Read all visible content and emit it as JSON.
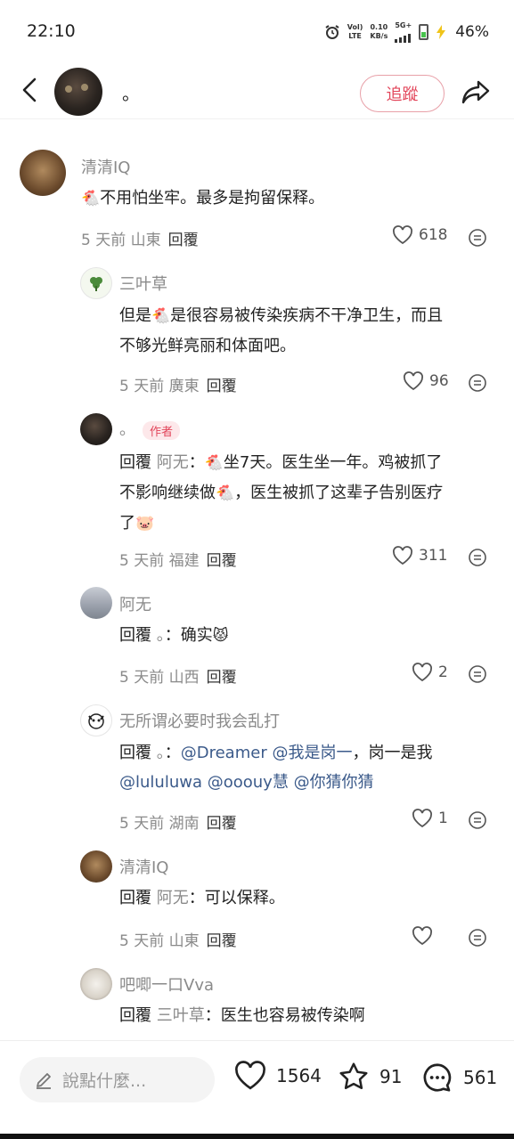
{
  "status_bar": {
    "time": "22:10",
    "volte": "Vol)",
    "lte": "LTE",
    "speed_value": "0.10",
    "speed_unit": "KB/s",
    "network": "5G+",
    "battery_pct": "46%"
  },
  "header": {
    "author_name": "。",
    "follow_label": "追蹤"
  },
  "comments": [
    {
      "name": "清清IQ",
      "text": "不用怕坐牢。最多是拘留保释。",
      "meta": "5 天前 山東",
      "reply_label": "回覆",
      "likes": "618"
    },
    {
      "name": "三叶草",
      "line1": "是很容易被传染疾病不干净卫生，而且",
      "line1_prefix": "但是",
      "line2": "不够光鲜亮丽和体面吧。",
      "meta": "5 天前 廣東",
      "reply_label": "回覆",
      "likes": "96"
    },
    {
      "name": "。",
      "author_tag": "作者",
      "reply_prefix": "回覆",
      "target": "阿无",
      "line1_a": "：",
      "line1_b": "坐7天。医生坐一年。鸡被抓了",
      "line2_a": "不影响继续做",
      "line2_b": "，医生被抓了这辈子告别医疗",
      "line3": "了",
      "meta": "5 天前 福建",
      "reply_label": "回覆",
      "likes": "311"
    },
    {
      "name": "阿无",
      "reply_prefix": "回覆",
      "target": "。",
      "text": "：确实",
      "meta": "5 天前 山西",
      "reply_label": "回覆",
      "likes": "2"
    },
    {
      "name": "无所谓必要时我会乱打",
      "reply_prefix": "回覆",
      "target": "。",
      "colon": "：",
      "m1": "@Dreamer",
      "m2": "@我是岗一",
      "plain": "，岗一是我",
      "m3": "@lululuwa",
      "m4": "@ooouy慧",
      "m5": "@你猜你猜",
      "meta": "5 天前 湖南",
      "reply_label": "回覆",
      "likes": "1"
    },
    {
      "name": "清清IQ",
      "reply_prefix": "回覆",
      "target": "阿无",
      "text": "：可以保释。",
      "meta": "5 天前 山東",
      "reply_label": "回覆",
      "likes": ""
    },
    {
      "name": "吧唧一口Vva",
      "reply_prefix": "回覆",
      "target": "三叶草",
      "text": "：医生也容易被传染啊"
    }
  ],
  "bottom_bar": {
    "input_placeholder": "說點什麼...",
    "likes": "1564",
    "stars": "91",
    "comments": "561"
  },
  "colors": {
    "accent": "#e2455a",
    "mention": "#3b5a8a",
    "muted": "#8a8a8a"
  },
  "icons": [
    "back-arrow-icon",
    "share-icon",
    "heart-icon",
    "more-icon",
    "star-icon",
    "comment-bubble-icon",
    "pencil-icon",
    "chicken-emoji-icon"
  ]
}
